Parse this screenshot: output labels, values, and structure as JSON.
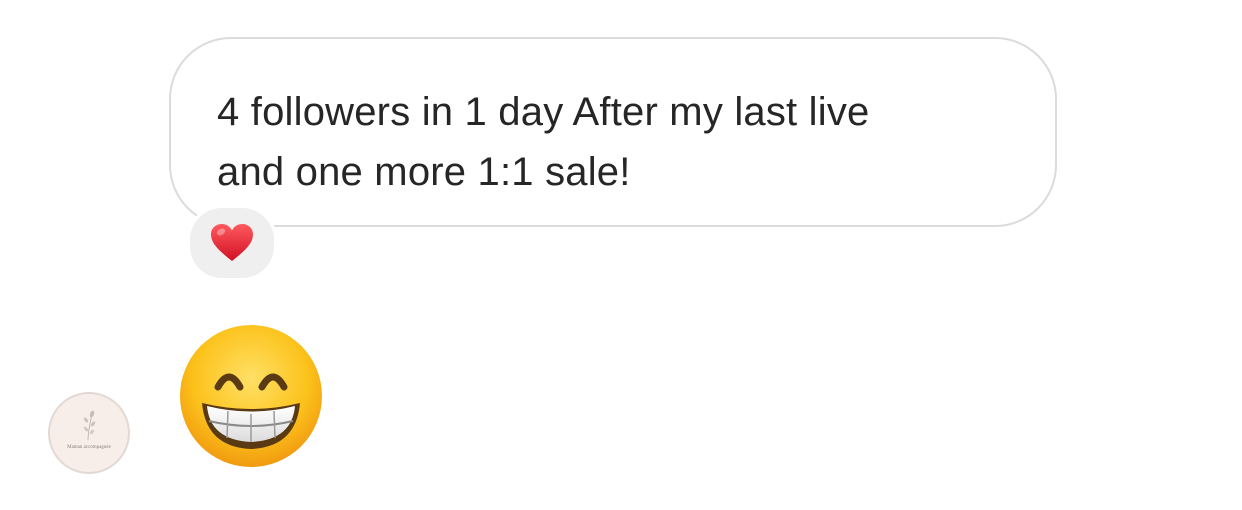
{
  "message": {
    "text": "4 followers in 1 day After my last live\nand one more 1:1 sale!",
    "reaction": {
      "icon": "red-heart-icon",
      "color": "#e3192d"
    }
  },
  "emoji_message": {
    "icon": "grinning-face-with-smiling-eyes-icon"
  },
  "avatar": {
    "name": "Maman accompagnée",
    "subtitle": ""
  },
  "colors": {
    "bubble_border": "#dbdbdb",
    "text": "#262626",
    "reaction_bg": "#efefef"
  }
}
